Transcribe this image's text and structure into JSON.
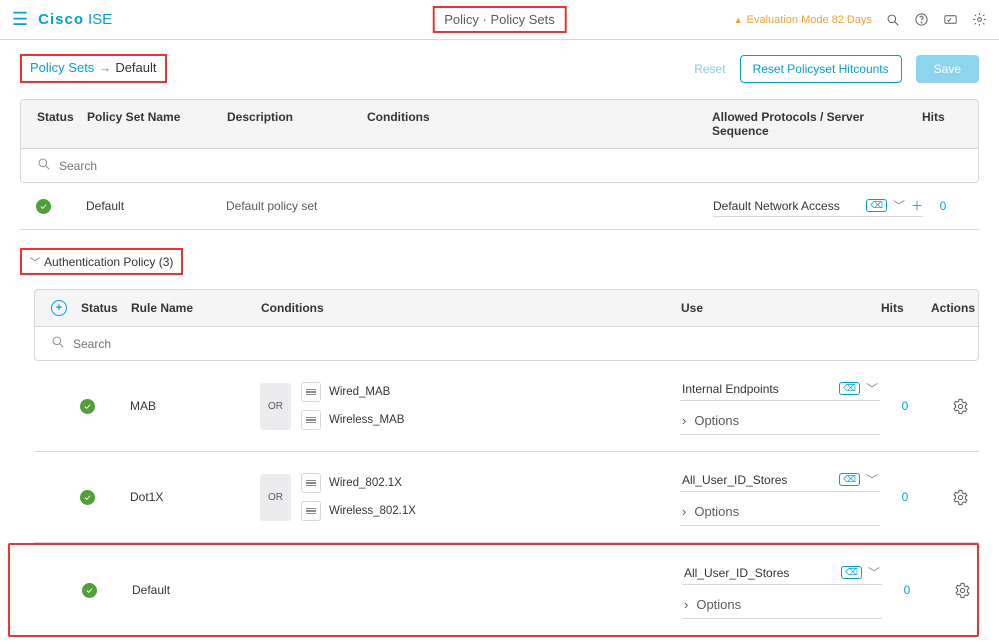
{
  "header": {
    "brand_cisco": "Cisco",
    "brand_product": "ISE",
    "page_title": "Policy · Policy Sets",
    "eval_notice": "Evaluation Mode 82 Days"
  },
  "breadcrumb": {
    "link": "Policy Sets",
    "arrow": "→",
    "current": "Default",
    "reset": "Reset",
    "reset_hitcounts": "Reset Policyset Hitcounts",
    "save": "Save"
  },
  "ps_table": {
    "head": {
      "status": "Status",
      "name": "Policy Set Name",
      "desc": "Description",
      "cond": "Conditions",
      "allowed": "Allowed Protocols / Server Sequence",
      "hits": "Hits"
    },
    "search_placeholder": "Search",
    "row": {
      "name": "Default",
      "desc": "Default policy set",
      "allowed": "Default Network Access",
      "hits": "0"
    }
  },
  "auth": {
    "section_label": "Authentication Policy (3)",
    "head": {
      "status": "Status",
      "rule": "Rule Name",
      "cond": "Conditions",
      "use": "Use",
      "hits": "Hits",
      "actions": "Actions"
    },
    "search_placeholder": "Search",
    "options_label": "Options",
    "rows": [
      {
        "name": "MAB",
        "logic": "OR",
        "conditions": [
          "Wired_MAB",
          "Wireless_MAB"
        ],
        "use": "Internal Endpoints",
        "hits": "0"
      },
      {
        "name": "Dot1X",
        "logic": "OR",
        "conditions": [
          "Wired_802.1X",
          "Wireless_802.1X"
        ],
        "use": "All_User_ID_Stores",
        "hits": "0"
      },
      {
        "name": "Default",
        "logic": "",
        "conditions": [],
        "use": "All_User_ID_Stores",
        "hits": "0"
      }
    ]
  }
}
